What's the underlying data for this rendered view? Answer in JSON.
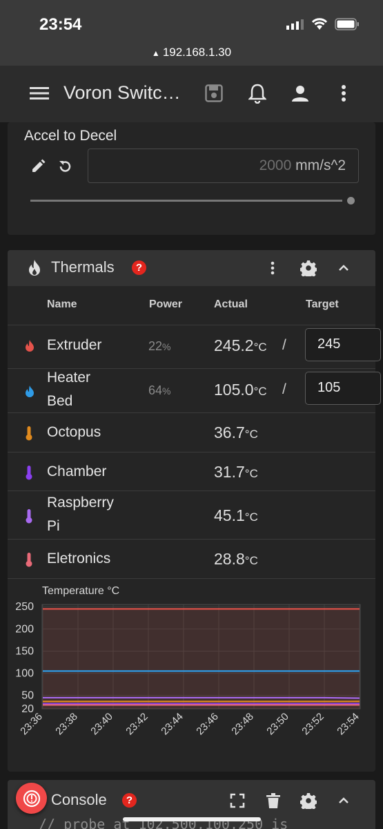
{
  "status_bar": {
    "time": "23:54",
    "url": "192.168.1.30"
  },
  "app_bar": {
    "title": "Voron Switc…",
    "icons": [
      "menu-icon",
      "save-icon",
      "bell-icon",
      "account-icon",
      "more-vert-icon"
    ]
  },
  "accel": {
    "label": "Accel to Decel",
    "value": "2000",
    "unit": "mm/s^2",
    "slider_fraction": 1.0
  },
  "thermals": {
    "title": "Thermals",
    "help": "?",
    "columns": {
      "name": "Name",
      "power": "Power",
      "actual": "Actual",
      "target": "Target"
    },
    "rows": [
      {
        "name": "Extruder",
        "power": "22",
        "actual": "245.2",
        "target": "245",
        "icon": "flame-icon",
        "color": "#e5534b"
      },
      {
        "name_line1": "Heater",
        "name_line2": "Bed",
        "power": "64",
        "actual": "105.0",
        "target": "105",
        "icon": "flame-icon",
        "color": "#2f9be6"
      },
      {
        "name": "Octopus",
        "actual": "36.7",
        "icon": "thermometer-icon",
        "color": "#e08a1e"
      },
      {
        "name": "Chamber",
        "actual": "31.7",
        "icon": "thermometer-icon",
        "color": "#8a3ff0"
      },
      {
        "name_line1": "Raspberry",
        "name_line2": "Pi",
        "actual": "45.1",
        "icon": "thermometer-icon",
        "color": "#a86af0"
      },
      {
        "name": "Eletronics",
        "actual": "28.8",
        "icon": "thermometer-icon",
        "color": "#e86a78"
      }
    ],
    "pct": "%",
    "unit": "°C",
    "slash": "/"
  },
  "chart_data": {
    "type": "line",
    "title": "",
    "ylabel": "Temperature °C",
    "xlabel": "",
    "ylim": [
      20,
      255
    ],
    "yticks": [
      20,
      50,
      100,
      150,
      200,
      250
    ],
    "categories": [
      "23:36",
      "23:38",
      "23:40",
      "23:42",
      "23:44",
      "23:46",
      "23:48",
      "23:50",
      "23:52",
      "23:54"
    ],
    "series": [
      {
        "values": [
          245,
          245,
          245,
          245,
          245,
          245,
          245,
          245,
          245,
          245
        ],
        "color": "#e5534b",
        "fill": true
      },
      {
        "values": [
          105,
          105,
          105,
          105,
          105,
          105,
          105,
          105,
          105,
          105
        ],
        "color": "#2f9be6"
      },
      {
        "values": [
          45,
          45,
          45,
          45,
          45,
          45,
          45,
          45,
          45,
          44
        ],
        "color": "#a86af0"
      },
      {
        "values": [
          36.5,
          36.5,
          36.5,
          36.5,
          36.5,
          36.5,
          36.5,
          36.5,
          36.5,
          36.7
        ],
        "color": "#e08a1e"
      },
      {
        "values": [
          31.5,
          31.5,
          31.5,
          31.5,
          31.5,
          31.5,
          31.5,
          31.5,
          31.5,
          31.7
        ],
        "color": "#8a3ff0"
      },
      {
        "values": [
          28.8,
          28.8,
          28.8,
          28.8,
          28.8,
          28.8,
          28.8,
          28.8,
          28.8,
          28.8
        ],
        "color": "#e86a78"
      }
    ],
    "grid": true
  },
  "console": {
    "title": "Console",
    "help": "?",
    "text": "// probe at 102.500,100.250 is"
  }
}
